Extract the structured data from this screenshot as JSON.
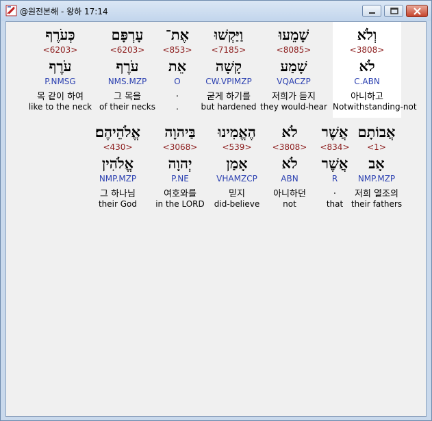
{
  "window": {
    "title": "@원전본해 - 왕하 17:14",
    "app_icon": "bible-app-icon"
  },
  "controls": {
    "minimize": "minimize-icon",
    "maximize": "maximize-icon",
    "close": "close-icon"
  },
  "rows": [
    {
      "words": [
        {
          "hebrew": "וְלֹא",
          "strong": "<3808>",
          "lemma": "לֹא",
          "morph": "C.ABN",
          "korean": "아니하고",
          "english": "Notwithstanding-not",
          "highlight": true
        },
        {
          "hebrew": "שָׁמֵעוּ",
          "strong": "<8085>",
          "lemma": "שָׁמַע",
          "morph": "VQACZP",
          "korean": "저희가 듣지",
          "english": "they would-hear"
        },
        {
          "hebrew": "וַיַּקְשׁוּ",
          "strong": "<7185>",
          "lemma": "קָשָׁה",
          "morph": "CW.VPIMZP",
          "korean": "굳게 하기를",
          "english": "but hardened"
        },
        {
          "hebrew": "אֶת־",
          "strong": "<853>",
          "lemma": "אֵת",
          "morph": "O",
          "korean": ".",
          "english": "."
        },
        {
          "hebrew": "עָרְפָּם",
          "strong": "<6203>",
          "lemma": "עֹרֶף",
          "morph": "NMS.MZP",
          "korean": "그 목을",
          "english": "of their necks"
        },
        {
          "hebrew": "כְּעֹרֶף",
          "strong": "<6203>",
          "lemma": "עֹרֶף",
          "morph": "P.NMSG",
          "korean": "목 같이 하여",
          "english": "like to the neck"
        }
      ]
    },
    {
      "words": [
        {
          "hebrew": "אֲבוֹתָם",
          "strong": "<1>",
          "lemma": "אָב",
          "morph": "NMP.MZP",
          "korean": "저희 열조의",
          "english": "their fathers"
        },
        {
          "hebrew": "אֲשֶׁר",
          "strong": "<834>",
          "lemma": "אֲשֶׁר",
          "morph": "R",
          "korean": ".",
          "english": "that"
        },
        {
          "hebrew": "לֹא",
          "strong": "<3808>",
          "lemma": "לֹא",
          "morph": "ABN",
          "korean": "아니하던",
          "english": "not"
        },
        {
          "hebrew": "הֶאֱמִינוּ",
          "strong": "<539>",
          "lemma": "אָמַן",
          "morph": "VHAMZCP",
          "korean": "믿지",
          "english": "did-believe"
        },
        {
          "hebrew": "בַּיהוָה",
          "strong": "<3068>",
          "lemma": "יְהוָה",
          "morph": "P.NE",
          "korean": "여호와를",
          "english": "in the LORD"
        },
        {
          "hebrew": "אֱלֹהֵיהֶם׃",
          "strong": "<430>",
          "lemma": "אֱלֹהִין",
          "morph": "NMP.MZP",
          "korean": "그 하나님",
          "english": "their God"
        }
      ]
    }
  ]
}
